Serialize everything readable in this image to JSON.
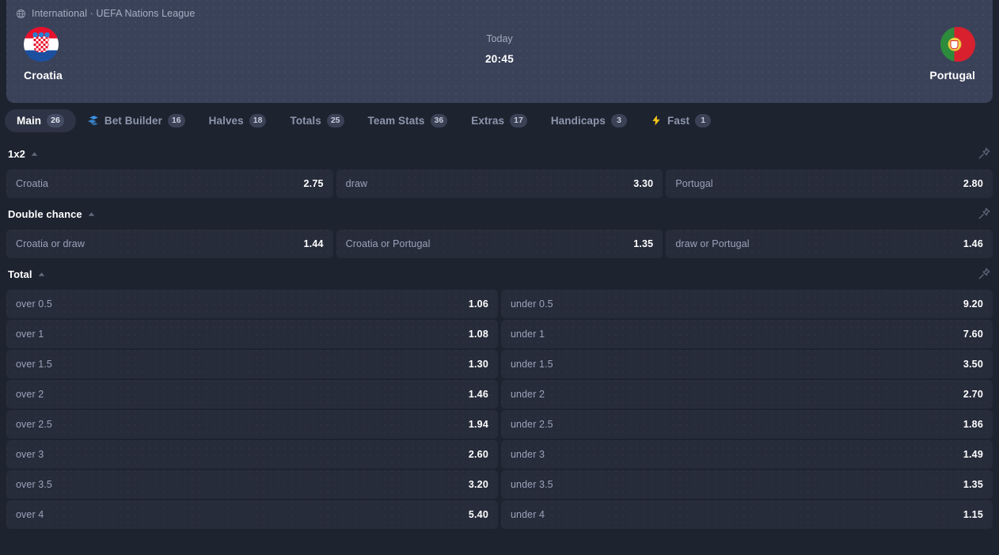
{
  "breadcrumb": {
    "icon": "globe-icon",
    "text": "International · UEFA Nations League"
  },
  "match": {
    "home_team": "Croatia",
    "away_team": "Portugal",
    "day": "Today",
    "time": "20:45"
  },
  "tabs": [
    {
      "label": "Main",
      "count": "26",
      "active": true,
      "icon": ""
    },
    {
      "label": "Bet Builder",
      "count": "16",
      "active": false,
      "icon": "bet-builder-icon"
    },
    {
      "label": "Halves",
      "count": "18",
      "active": false,
      "icon": ""
    },
    {
      "label": "Totals",
      "count": "25",
      "active": false,
      "icon": ""
    },
    {
      "label": "Team Stats",
      "count": "36",
      "active": false,
      "icon": ""
    },
    {
      "label": "Extras",
      "count": "17",
      "active": false,
      "icon": ""
    },
    {
      "label": "Handicaps",
      "count": "3",
      "active": false,
      "icon": ""
    },
    {
      "label": "Fast",
      "count": "1",
      "active": false,
      "icon": "lightning-icon"
    }
  ],
  "markets": [
    {
      "title": "1x2",
      "columns": 3,
      "outcomes": [
        {
          "name": "Croatia",
          "odds": "2.75"
        },
        {
          "name": "draw",
          "odds": "3.30"
        },
        {
          "name": "Portugal",
          "odds": "2.80"
        }
      ]
    },
    {
      "title": "Double chance",
      "columns": 3,
      "outcomes": [
        {
          "name": "Croatia or draw",
          "odds": "1.44"
        },
        {
          "name": "Croatia or Portugal",
          "odds": "1.35"
        },
        {
          "name": "draw or Portugal",
          "odds": "1.46"
        }
      ]
    },
    {
      "title": "Total",
      "columns": 2,
      "outcomes": [
        {
          "name": "over 0.5",
          "odds": "1.06"
        },
        {
          "name": "under 0.5",
          "odds": "9.20"
        },
        {
          "name": "over 1",
          "odds": "1.08"
        },
        {
          "name": "under 1",
          "odds": "7.60"
        },
        {
          "name": "over 1.5",
          "odds": "1.30"
        },
        {
          "name": "under 1.5",
          "odds": "3.50"
        },
        {
          "name": "over 2",
          "odds": "1.46"
        },
        {
          "name": "under 2",
          "odds": "2.70"
        },
        {
          "name": "over 2.5",
          "odds": "1.94"
        },
        {
          "name": "under 2.5",
          "odds": "1.86"
        },
        {
          "name": "over 3",
          "odds": "2.60"
        },
        {
          "name": "under 3",
          "odds": "1.49"
        },
        {
          "name": "over 3.5",
          "odds": "3.20"
        },
        {
          "name": "under 3.5",
          "odds": "1.35"
        },
        {
          "name": "over 4",
          "odds": "5.40"
        },
        {
          "name": "under 4",
          "odds": "1.15"
        }
      ]
    }
  ],
  "colors": {
    "page_bg": "#1e2330",
    "header_card_bg": "#3a4259",
    "row_bg": "#272c3b",
    "accent_blue": "#3d9bf0",
    "accent_yellow": "#f5c518",
    "text_primary": "#ffffff",
    "text_muted": "#9aa3b8"
  }
}
